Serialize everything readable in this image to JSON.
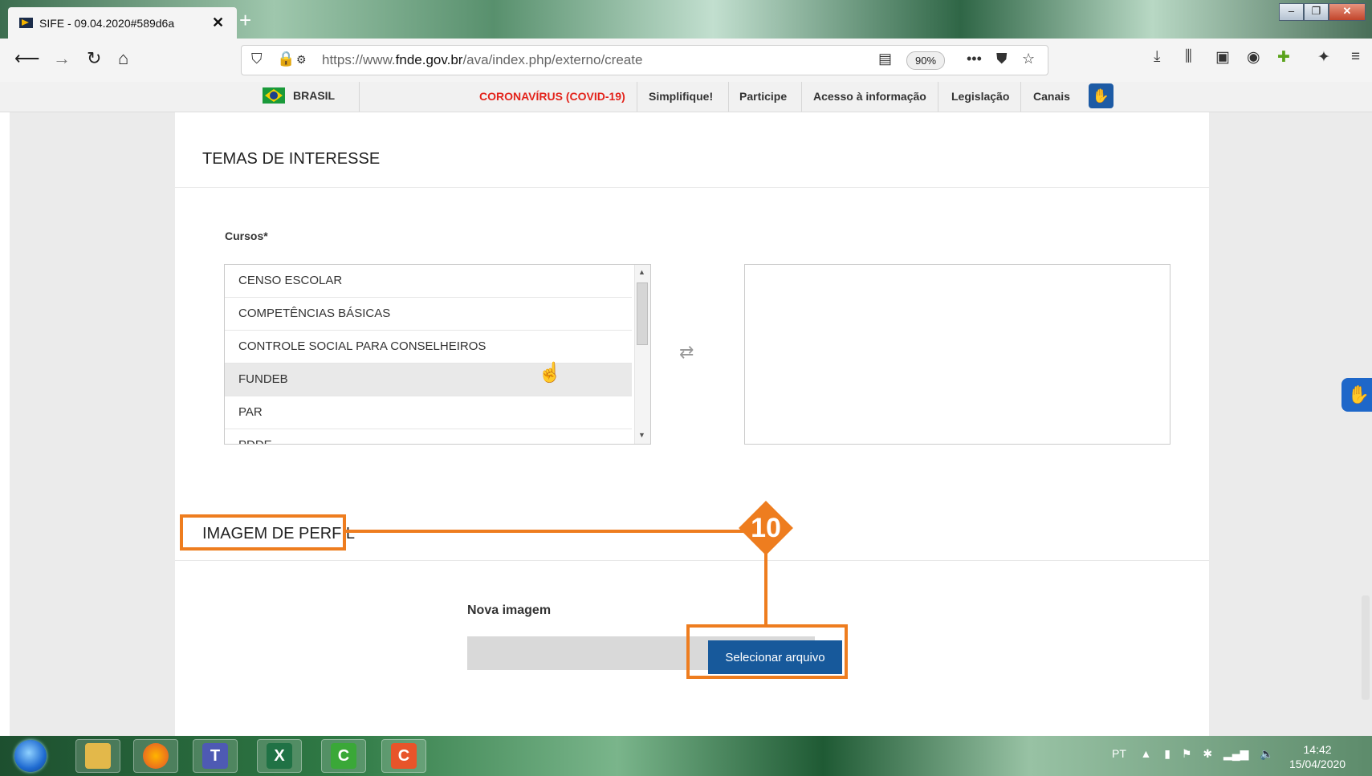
{
  "browser": {
    "tab_title": "SIFE - 09.04.2020#589d6a",
    "tab_close": "✕",
    "new_tab": "+",
    "url_prefix": "https://www.",
    "url_domain": "fnde.gov.br",
    "url_path": "/ava/index.php/externo/create",
    "zoom": "90%",
    "window_controls": [
      "–",
      "❐",
      "✕"
    ]
  },
  "govbar": {
    "brasil": "BRASIL",
    "links": [
      "CORONAVÍRUS (COVID-19)",
      "Simplifique!",
      "Participe",
      "Acesso à informação",
      "Legislação",
      "Canais"
    ],
    "accent_color": "#e3231b"
  },
  "sections": {
    "temas": "TEMAS DE INTERESSE",
    "imagem": "IMAGEM DE PERFIL"
  },
  "cursos": {
    "label": "Cursos*",
    "options": [
      "CENSO ESCOLAR",
      "COMPETÊNCIAS BÁSICAS",
      "CONTROLE SOCIAL PARA CONSELHEIROS",
      "FUNDEB",
      "PAR",
      "PDDE"
    ],
    "highlighted": "FUNDEB"
  },
  "upload": {
    "label": "Nova imagem",
    "button": "Selecionar arquivo",
    "button_color": "#17599b"
  },
  "annotation": {
    "step": "10",
    "color": "#ee7d1f"
  },
  "taskbar": {
    "language": "PT",
    "time": "14:42",
    "date": "15/04/2020"
  }
}
